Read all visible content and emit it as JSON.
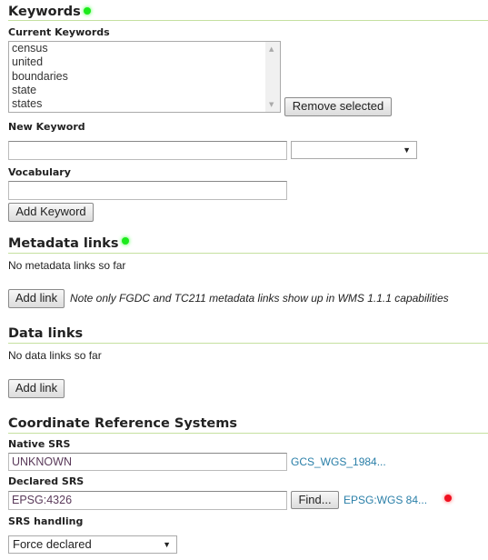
{
  "keywords": {
    "title": "Keywords",
    "current_label": "Current Keywords",
    "items": [
      "census",
      "united",
      "boundaries",
      "state",
      "states"
    ],
    "remove_button": "Remove selected",
    "new_label": "New Keyword",
    "new_value": "",
    "vocab_select": "",
    "vocabulary_label": "Vocabulary",
    "vocabulary_value": "",
    "add_button": "Add Keyword",
    "status": "green"
  },
  "metadata_links": {
    "title": "Metadata links",
    "empty": "No metadata links so far",
    "add_button": "Add link",
    "note": "Note only FGDC and TC211 metadata links show up in WMS 1.1.1 capabilities",
    "status": "green"
  },
  "data_links": {
    "title": "Data links",
    "empty": "No data links so far",
    "add_button": "Add link"
  },
  "crs": {
    "title": "Coordinate Reference Systems",
    "native_label": "Native SRS",
    "native_value": "UNKNOWN",
    "native_link": "GCS_WGS_1984...",
    "declared_label": "Declared SRS",
    "declared_value": "EPSG:4326",
    "find_button": "Find...",
    "declared_link": "EPSG:WGS 84...",
    "status": "red",
    "handling_label": "SRS handling",
    "handling_value": "Force declared"
  },
  "colors": {
    "rule": "#c5e0a0",
    "link": "#2a7fa8",
    "ok": "#1bea1b",
    "error": "#f01020"
  }
}
